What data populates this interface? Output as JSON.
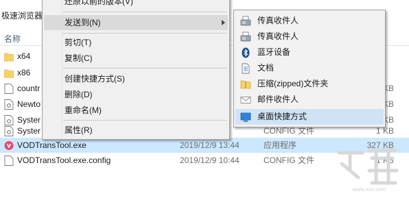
{
  "explorer": {
    "address_fragment": "极速浏览器",
    "column_header_name": "名称",
    "rows": [
      {
        "name": "x64",
        "date": "",
        "type": "",
        "size": "",
        "icon": "folder-icon"
      },
      {
        "name": "x86",
        "date": "",
        "type": "",
        "size": "",
        "icon": "folder-icon"
      },
      {
        "name": "countr",
        "date": "",
        "type": "",
        "size": "KB",
        "icon": "file-icon"
      },
      {
        "name": "Newto",
        "date": "",
        "type": "",
        "size": "KB",
        "icon": "config-file-icon"
      },
      {
        "name": "Syster",
        "date": "",
        "type": "",
        "size": "KB",
        "icon": "config-file-icon"
      },
      {
        "name": "Syster",
        "date": "",
        "type": "CONFIG 文件",
        "size": "1 KB",
        "icon": "config-file-icon"
      },
      {
        "name": "VODTransTool.exe",
        "date": "2019/12/9 13:44",
        "type": "应用程序",
        "size": "327 KB",
        "icon": "app-exe-icon"
      },
      {
        "name": "VODTransTool.exe.config",
        "date": "2019/12/9 10:44",
        "type": "CONFIG 文件",
        "size": "1 KB",
        "icon": "file-icon"
      }
    ]
  },
  "context_menu": {
    "partial_top": "还原以前的版本(V)",
    "send_to": "发送到(N)",
    "cut": "剪切(T)",
    "copy": "复制(C)",
    "create_shortcut": "创建快捷方式(S)",
    "delete": "删除(D)",
    "rename": "重命名(M)",
    "properties": "属性(R)"
  },
  "send_to_menu": {
    "items": [
      {
        "label": "传真收件人",
        "icon": "fax-icon"
      },
      {
        "label": "传真收件人",
        "icon": "fax-icon"
      },
      {
        "label": "蓝牙设备",
        "icon": "bluetooth-icon"
      },
      {
        "label": "文档",
        "icon": "document-icon"
      },
      {
        "label": "压缩(zipped)文件夹",
        "icon": "zip-folder-icon"
      },
      {
        "label": "邮件收件人",
        "icon": "mail-icon"
      },
      {
        "label": "桌面快捷方式",
        "icon": "desktop-icon"
      }
    ]
  },
  "colors": {
    "selected_row": "#cce8ff",
    "menu_bg": "#f0f0f0",
    "menu_hover": "#dadada",
    "submenu_hover": "#cfe3f5",
    "folder": "#f6d26b"
  }
}
